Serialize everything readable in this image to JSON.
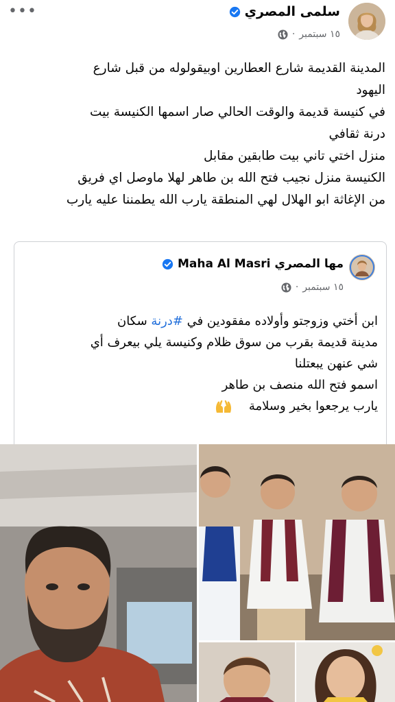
{
  "post": {
    "author": "سلمى المصري",
    "date": "١٥ سبتمبر",
    "separator": "·",
    "lines": [
      "المدينة القديمة شارع العطارين اوبيقولوله من قبل شارع",
      "اليهود",
      "في كنيسة قديمة  والوقت الحالي صار اسمها الكنيسة بيت",
      "درنة ثقافي",
      "منزل اختي تاني بيت طابقين مقابل",
      "الكنيسة منزل نجيب فتح الله بن طاهر لهلا ماوصل اي فريق",
      "من الإغاثة ابو الهلال لهي المنطقة يارب الله يطمننا عليه يارب"
    ]
  },
  "shared_post": {
    "author": "مها المصري Maha Al Masri",
    "date": "١٥ سبتمبر",
    "separator": "·",
    "line1_before": "ابن أختي وزوجتو وأولاده مفقودين في ",
    "hashtag": "#درنة",
    "line1_after": " سكان",
    "lines": [
      "مدينة قديمة بقرب من سوق ظلام وكنيسة يلي بيعرف أي",
      "شي عنهن يبعتلنا",
      "اسمو فتح الله منصف بن طاهر"
    ],
    "last_line": "يارب يرجعوا بخير وسلامة"
  },
  "icons": {
    "more": "more-dots-icon",
    "verified": "verified-badge-icon",
    "audience": "globe-icon",
    "emoji": "raising-hands-emoji-icon"
  },
  "colors": {
    "verified_blue": "#1877f2",
    "hashtag_blue": "#216fdb",
    "meta_gray": "#65676b",
    "border": "#ced0d4"
  },
  "more_glyph": "•••"
}
